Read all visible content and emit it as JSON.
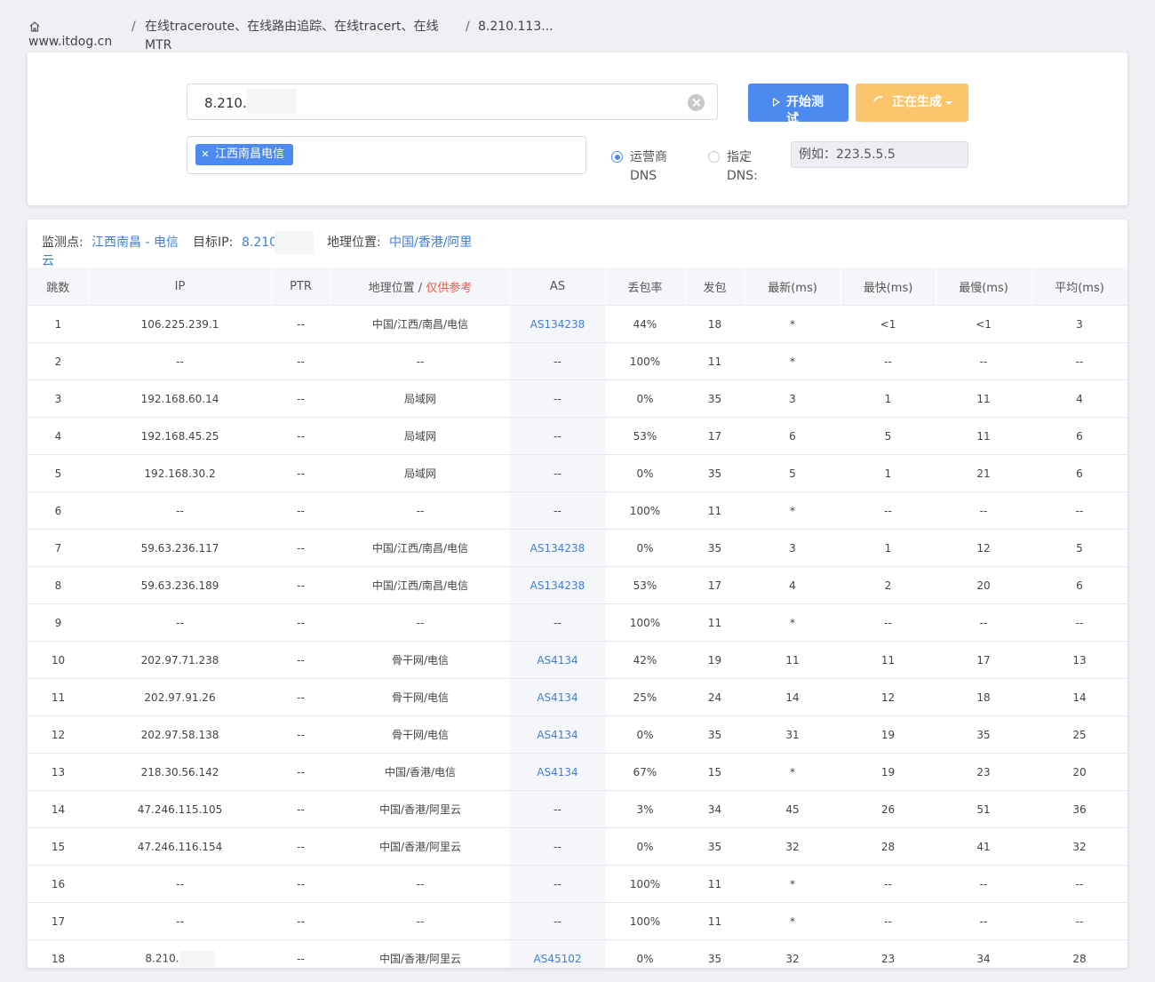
{
  "breadcrumb": {
    "home_label": "www.itdog.cn",
    "separator": "/",
    "tool_label": "在线traceroute、在线路由追踪、在线tracert、在线MTR",
    "target_label": "8.210.113..."
  },
  "form": {
    "target_value": "8.210.",
    "start_label": "开始测试",
    "generate_label": "正在生成",
    "node_tag": "江西南昌电信",
    "dns_option_operator": "运营商DNS",
    "dns_option_custom": "指定DNS:",
    "dns_selected": "运营商DNS",
    "dns_placeholder": "例如：223.5.5.5"
  },
  "summary": {
    "node_label": "监测点:",
    "node_value_line1": "江西南昌 - 电信",
    "node_value_line2": "云",
    "target_label": "目标IP:",
    "target_value": "8.210.",
    "geo_label": "地理位置:",
    "geo_value": "中国/香港/阿里"
  },
  "table": {
    "headers": {
      "hop": "跳数",
      "ip": "IP",
      "ptr": "PTR",
      "geo": "地理位置 / ",
      "geo_note": "仅供参考",
      "as": "AS",
      "loss": "丢包率",
      "sent": "发包",
      "last": "最新(ms)",
      "best": "最快(ms)",
      "worst": "最慢(ms)",
      "avg": "平均(ms)"
    },
    "rows": [
      {
        "hop": "1",
        "ip": "106.225.239.1",
        "ptr": "--",
        "geo": "中国/江西/南昌/电信",
        "as": "AS134238",
        "loss": "44%",
        "sent": "18",
        "last": "*",
        "best": "<1",
        "worst": "<1",
        "avg": "3"
      },
      {
        "hop": "2",
        "ip": "--",
        "ptr": "--",
        "geo": "--",
        "as": "--",
        "loss": "100%",
        "sent": "11",
        "last": "*",
        "best": "--",
        "worst": "--",
        "avg": "--"
      },
      {
        "hop": "3",
        "ip": "192.168.60.14",
        "ptr": "--",
        "geo": "局域网",
        "as": "--",
        "loss": "0%",
        "sent": "35",
        "last": "3",
        "best": "1",
        "worst": "11",
        "avg": "4"
      },
      {
        "hop": "4",
        "ip": "192.168.45.25",
        "ptr": "--",
        "geo": "局域网",
        "as": "--",
        "loss": "53%",
        "sent": "17",
        "last": "6",
        "best": "5",
        "worst": "11",
        "avg": "6"
      },
      {
        "hop": "5",
        "ip": "192.168.30.2",
        "ptr": "--",
        "geo": "局域网",
        "as": "--",
        "loss": "0%",
        "sent": "35",
        "last": "5",
        "best": "1",
        "worst": "21",
        "avg": "6"
      },
      {
        "hop": "6",
        "ip": "--",
        "ptr": "--",
        "geo": "--",
        "as": "--",
        "loss": "100%",
        "sent": "11",
        "last": "*",
        "best": "--",
        "worst": "--",
        "avg": "--"
      },
      {
        "hop": "7",
        "ip": "59.63.236.117",
        "ptr": "--",
        "geo": "中国/江西/南昌/电信",
        "as": "AS134238",
        "loss": "0%",
        "sent": "35",
        "last": "3",
        "best": "1",
        "worst": "12",
        "avg": "5"
      },
      {
        "hop": "8",
        "ip": "59.63.236.189",
        "ptr": "--",
        "geo": "中国/江西/南昌/电信",
        "as": "AS134238",
        "loss": "53%",
        "sent": "17",
        "last": "4",
        "best": "2",
        "worst": "20",
        "avg": "6"
      },
      {
        "hop": "9",
        "ip": "--",
        "ptr": "--",
        "geo": "--",
        "as": "--",
        "loss": "100%",
        "sent": "11",
        "last": "*",
        "best": "--",
        "worst": "--",
        "avg": "--"
      },
      {
        "hop": "10",
        "ip": "202.97.71.238",
        "ptr": "--",
        "geo": "骨干网/电信",
        "as": "AS4134",
        "loss": "42%",
        "sent": "19",
        "last": "11",
        "best": "11",
        "worst": "17",
        "avg": "13"
      },
      {
        "hop": "11",
        "ip": "202.97.91.26",
        "ptr": "--",
        "geo": "骨干网/电信",
        "as": "AS4134",
        "loss": "25%",
        "sent": "24",
        "last": "14",
        "best": "12",
        "worst": "18",
        "avg": "14"
      },
      {
        "hop": "12",
        "ip": "202.97.58.138",
        "ptr": "--",
        "geo": "骨干网/电信",
        "as": "AS4134",
        "loss": "0%",
        "sent": "35",
        "last": "31",
        "best": "19",
        "worst": "35",
        "avg": "25"
      },
      {
        "hop": "13",
        "ip": "218.30.56.142",
        "ptr": "--",
        "geo": "中国/香港/电信",
        "as": "AS4134",
        "loss": "67%",
        "sent": "15",
        "last": "*",
        "best": "19",
        "worst": "23",
        "avg": "20"
      },
      {
        "hop": "14",
        "ip": "47.246.115.105",
        "ptr": "--",
        "geo": "中国/香港/阿里云",
        "as": "--",
        "loss": "3%",
        "sent": "34",
        "last": "45",
        "best": "26",
        "worst": "51",
        "avg": "36"
      },
      {
        "hop": "15",
        "ip": "47.246.116.154",
        "ptr": "--",
        "geo": "中国/香港/阿里云",
        "as": "--",
        "loss": "0%",
        "sent": "35",
        "last": "32",
        "best": "28",
        "worst": "41",
        "avg": "32"
      },
      {
        "hop": "16",
        "ip": "--",
        "ptr": "--",
        "geo": "--",
        "as": "--",
        "loss": "100%",
        "sent": "11",
        "last": "*",
        "best": "--",
        "worst": "--",
        "avg": "--"
      },
      {
        "hop": "17",
        "ip": "--",
        "ptr": "--",
        "geo": "--",
        "as": "--",
        "loss": "100%",
        "sent": "11",
        "last": "*",
        "best": "--",
        "worst": "--",
        "avg": "--"
      },
      {
        "hop": "18",
        "ip": "8.210.",
        "ptr": "--",
        "geo": "中国/香港/阿里云",
        "as": "AS45102",
        "loss": "0%",
        "sent": "35",
        "last": "32",
        "best": "23",
        "worst": "34",
        "avg": "28"
      }
    ]
  },
  "colors": {
    "primary": "#4d8af0",
    "warning": "#fcc56c",
    "link": "#3f7fd8",
    "note_red": "#e45c4c",
    "background": "#eef0f4"
  }
}
